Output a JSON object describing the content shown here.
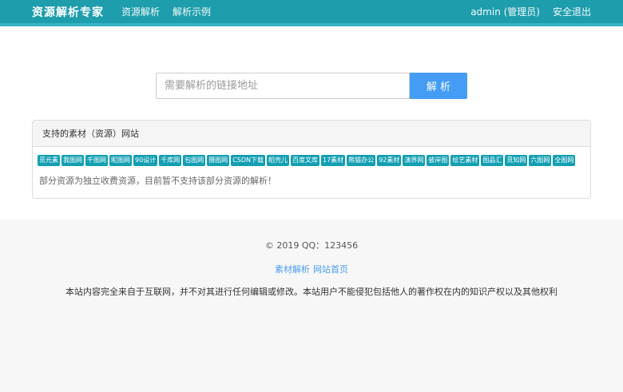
{
  "colors": {
    "navbar_bg": "#1e9dac",
    "navbar_strip": "#35b5c4",
    "badge_bg": "#139fb3",
    "button_bg": "#449cf4",
    "link_blue": "#4a9cf3",
    "footer_bg": "#f7f7f7"
  },
  "navbar": {
    "brand": "资源解析专家",
    "menu": [
      "资源解析",
      "解析示例"
    ],
    "user_label": "admin (管理员)",
    "logout_label": "安全退出"
  },
  "search": {
    "placeholder": "需要解析的链接地址",
    "value": "",
    "button_label": "解 析"
  },
  "panel": {
    "title": "支持的素材（资源）网站",
    "sites": [
      "觅元素",
      "我图网",
      "千图网",
      "昵图网",
      "90设计",
      "千库网",
      "包图网",
      "摄图网",
      "CSDN下载",
      "稻壳儿",
      "百度文库",
      "17素材",
      "熊猫办公",
      "92素材",
      "演界网",
      "彼岸图",
      "绘艺素材",
      "图品汇",
      "觅知网",
      "六图网",
      "全图网"
    ],
    "note": "部分资源为独立收费资源，目前暂不支持该部分资源的解析！"
  },
  "footer": {
    "copyright": "© 2019 QQ：123456",
    "links": [
      "素材解析",
      "网站首页"
    ],
    "disclaimer": "本站内容完全来自于互联网，并不对其进行任何编辑或修改。本站用户不能侵犯包括他人的著作权在内的知识产权以及其他权利"
  }
}
